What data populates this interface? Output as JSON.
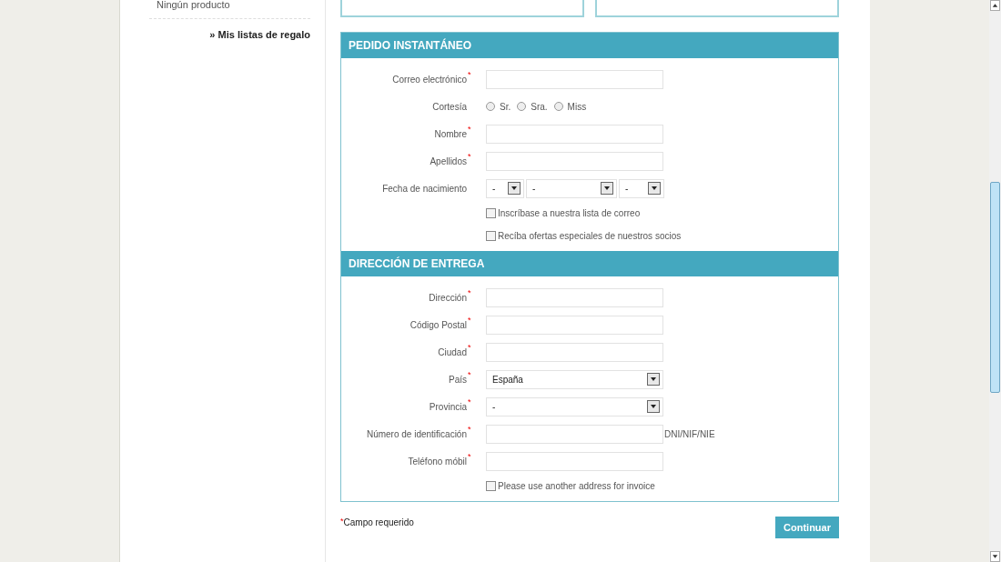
{
  "sidebar": {
    "cart_text": "Ningún producto",
    "link": "» Mis listas de regalo"
  },
  "sections": [
    {
      "title": "PEDIDO INSTANTÁNEO",
      "fields": [
        {
          "kind": "text",
          "label": "Correo electrónico",
          "required_mark": "*"
        },
        {
          "kind": "radio",
          "label": "Cortesía",
          "options": [
            {
              "label": "Sr.",
              "selected": false
            },
            {
              "label": "Sra.",
              "selected": false
            },
            {
              "label": "Miss",
              "selected": false
            }
          ]
        },
        {
          "kind": "text",
          "label": "Nombre",
          "required_mark": "*"
        },
        {
          "kind": "text",
          "label": "Apellidos",
          "required_mark": "*"
        },
        {
          "kind": "date",
          "label": "Fecha de nacimiento",
          "selects": [
            "-",
            "-",
            "-"
          ]
        },
        {
          "kind": "checkbox",
          "label": "Inscríbase a nuestra lista de correo",
          "checked": false
        },
        {
          "kind": "checkbox",
          "label": "Recíba ofertas especiales de nuestros socios",
          "checked": false
        }
      ]
    },
    {
      "title": "DIRECCIÓN DE ENTREGA",
      "fields": [
        {
          "kind": "text",
          "label": "Dirección",
          "required_mark": "*"
        },
        {
          "kind": "text",
          "label": "Código Postal",
          "required_mark": "*"
        },
        {
          "kind": "text",
          "label": "Ciudad",
          "required_mark": "*"
        },
        {
          "kind": "select",
          "label": "País",
          "required_mark": "*",
          "value": "España"
        },
        {
          "kind": "select",
          "label": "Provincia",
          "required_mark": "*",
          "value": "-"
        },
        {
          "kind": "text",
          "label": "Número de identificación",
          "required_mark": "*",
          "hint": "DNI/NIF/NIE"
        },
        {
          "kind": "text",
          "label": "Teléfono móbil",
          "required_mark": "*"
        },
        {
          "kind": "checkbox",
          "label": "Please use another address for invoice",
          "checked": false
        }
      ]
    }
  ],
  "required_note_mark": "*",
  "required_note": "Campo requerido",
  "continue_button": "Continuar"
}
